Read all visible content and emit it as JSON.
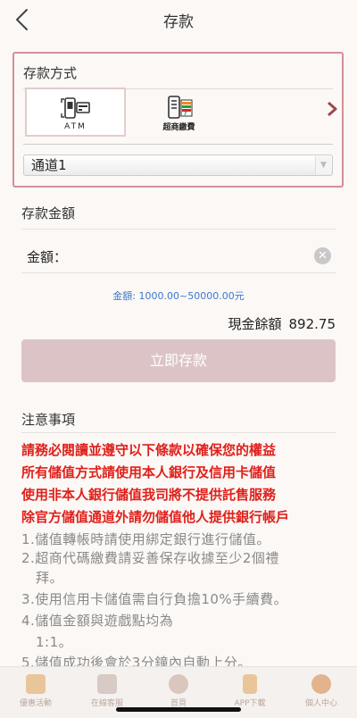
{
  "header": {
    "title": "存款"
  },
  "deposit_method": {
    "label": "存款方式",
    "options": [
      {
        "label": "ATM",
        "icon": "atm-icon",
        "selected": true
      },
      {
        "label": "超商繳費",
        "icon": "convenience-store-icon",
        "selected": false
      }
    ],
    "channel": "通道1"
  },
  "amount": {
    "section_label": "存款金額",
    "field_label": "金額：",
    "value": "",
    "range_hint": "金額: 1000.00~50000.00元",
    "balance_label": "現金餘額",
    "balance_value": "892.75",
    "submit_label": "立即存款"
  },
  "notes": {
    "title": "注意事項",
    "warnings": [
      "請務必閱讀並遵守以下條款以確保您的權益",
      "所有儲值方式請使用本人銀行及信用卡儲值",
      "使用非本人銀行儲值我司將不提供託售服務",
      "除官方儲值通道外請勿儲值他人提供銀行帳戶"
    ],
    "rules": [
      "1.儲值轉帳時請使用綁定銀行進行儲值。",
      "2.超商代碼繳費請妥善保存收據至少2個禮",
      "拜。",
      "3.使用信用卡儲值需自行負擔10%手續費。",
      "4.儲值金額與遊戲點均為",
      "1:1。",
      "5.儲值成功後會於3分鐘內自動上分。"
    ]
  },
  "tabbar": {
    "items": [
      {
        "label": "優惠活動",
        "icon": "promotion-icon"
      },
      {
        "label": "在線客服",
        "icon": "chat-icon"
      },
      {
        "label": "首頁",
        "icon": "home-icon"
      },
      {
        "label": "APP下載",
        "icon": "download-icon"
      },
      {
        "label": "個人中心",
        "icon": "user-icon"
      }
    ]
  },
  "colors": {
    "accent": "#d58f95",
    "warning": "#e0201a",
    "hint": "#3f78c8",
    "button": "#dcc4c6",
    "tab_label": "#b9a79f"
  }
}
